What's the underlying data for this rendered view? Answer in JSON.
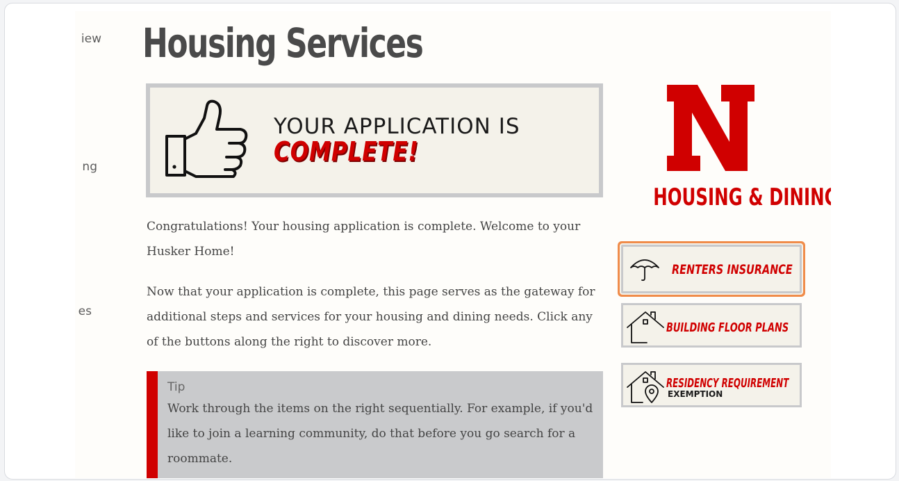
{
  "sidenav": {
    "items": [
      "iew",
      "ng",
      "es"
    ]
  },
  "page": {
    "title": "Housing Services"
  },
  "banner": {
    "line1": "YOUR APPLICATION IS",
    "line2": "COMPLETE!"
  },
  "content": {
    "paragraph1": "Congratulations! Your housing application is complete. Welcome to your Husker Home!",
    "paragraph2": "Now that your application is complete, this page serves as the gateway for additional steps and services for your housing and dining needs. Click any of the buttons along the right to discover more."
  },
  "tip": {
    "label": "Tip",
    "text": "Work through the items on the right sequentially. For example, if you'd like to join a learning community, do that before you go search for a roommate."
  },
  "logo": {
    "text": "HOUSING & DINING"
  },
  "sidebar_buttons": [
    {
      "label": "RENTERS INSURANCE",
      "icon": "umbrella-icon"
    },
    {
      "label": "BUILDING FLOOR PLANS",
      "icon": "house-icon"
    },
    {
      "label": "RESIDENCY REQUIREMENT",
      "sub": "EXEMPTION",
      "icon": "house-location-icon"
    }
  ],
  "colors": {
    "brand_red": "#d00000",
    "highlight": "#f08c4a",
    "tip_background": "#c9cacc"
  }
}
